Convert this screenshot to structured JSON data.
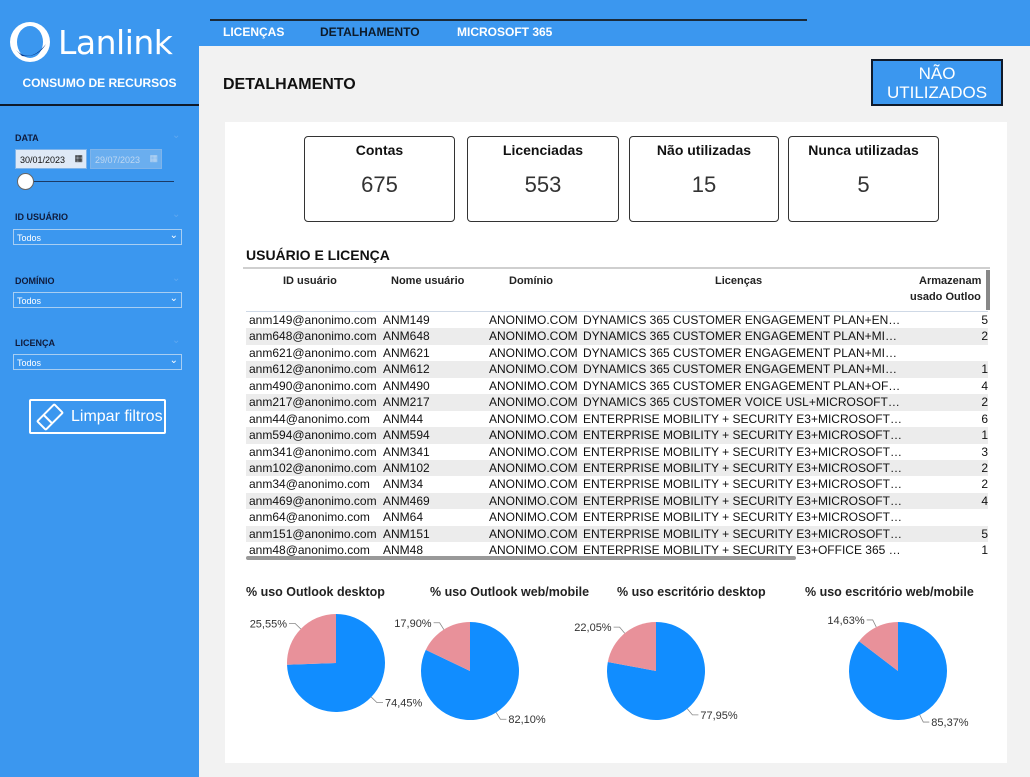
{
  "brand": {
    "name": "Lanlink",
    "subtitle": "CONSUMO DE RECURSOS"
  },
  "colors": {
    "accent": "#3b97ef",
    "pie_main": "#118dff",
    "pie_secondary": "#e8919a"
  },
  "filters": {
    "date": {
      "label": "DATA",
      "start": "30/01/2023",
      "end": "29/07/2023"
    },
    "user_id": {
      "label": "ID USUÁRIO",
      "value": "Todos"
    },
    "domain": {
      "label": "DOMÍNIO",
      "value": "Todos"
    },
    "license": {
      "label": "LICENÇA",
      "value": "Todos"
    },
    "clear_label": "Limpar filtros"
  },
  "tabs": [
    {
      "label": "LICENÇAS",
      "active": false
    },
    {
      "label": "DETALHAMENTO",
      "active": true
    },
    {
      "label": "MICROSOFT 365",
      "active": false
    }
  ],
  "page": {
    "title": "DETALHAMENTO",
    "button": "NÃO UTILIZADOS"
  },
  "kpis": [
    {
      "label": "Contas",
      "value": "675"
    },
    {
      "label": "Licenciadas",
      "value": "553"
    },
    {
      "label": "Não utilizadas",
      "value": "15"
    },
    {
      "label": "Nunca utilizadas",
      "value": "5"
    }
  ],
  "table": {
    "title": "USUÁRIO E LICENÇA",
    "headers": [
      "ID usuário",
      "Nome usuário",
      "Domínio",
      "Licenças",
      "Armazenam",
      "usado Outloo"
    ],
    "rows": [
      [
        "anm149@anonimo.com",
        "ANM149",
        "ANONIMO.COM",
        "DYNAMICS 365 CUSTOMER ENGAGEMENT PLAN+EN…",
        "5"
      ],
      [
        "anm648@anonimo.com",
        "ANM648",
        "ANONIMO.COM",
        "DYNAMICS 365 CUSTOMER ENGAGEMENT PLAN+MI…",
        "2"
      ],
      [
        "anm621@anonimo.com",
        "ANM621",
        "ANONIMO.COM",
        "DYNAMICS 365 CUSTOMER ENGAGEMENT PLAN+MI…",
        ""
      ],
      [
        "anm612@anonimo.com",
        "ANM612",
        "ANONIMO.COM",
        "DYNAMICS 365 CUSTOMER ENGAGEMENT PLAN+MI…",
        "1"
      ],
      [
        "anm490@anonimo.com",
        "ANM490",
        "ANONIMO.COM",
        "DYNAMICS 365 CUSTOMER ENGAGEMENT PLAN+OF…",
        "4"
      ],
      [
        "anm217@anonimo.com",
        "ANM217",
        "ANONIMO.COM",
        "DYNAMICS 365 CUSTOMER VOICE USL+MICROSOFT…",
        "2"
      ],
      [
        "anm44@anonimo.com",
        "ANM44",
        "ANONIMO.COM",
        "ENTERPRISE MOBILITY + SECURITY E3+MICROSOFT…",
        "6"
      ],
      [
        "anm594@anonimo.com",
        "ANM594",
        "ANONIMO.COM",
        "ENTERPRISE MOBILITY + SECURITY E3+MICROSOFT…",
        "1"
      ],
      [
        "anm341@anonimo.com",
        "ANM341",
        "ANONIMO.COM",
        "ENTERPRISE MOBILITY + SECURITY E3+MICROSOFT…",
        "3"
      ],
      [
        "anm102@anonimo.com",
        "ANM102",
        "ANONIMO.COM",
        "ENTERPRISE MOBILITY + SECURITY E3+MICROSOFT…",
        "2"
      ],
      [
        "anm34@anonimo.com",
        "ANM34",
        "ANONIMO.COM",
        "ENTERPRISE MOBILITY + SECURITY E3+MICROSOFT…",
        "2"
      ],
      [
        "anm469@anonimo.com",
        "ANM469",
        "ANONIMO.COM",
        "ENTERPRISE MOBILITY + SECURITY E3+MICROSOFT…",
        "4"
      ],
      [
        "anm64@anonimo.com",
        "ANM64",
        "ANONIMO.COM",
        "ENTERPRISE MOBILITY + SECURITY E3+MICROSOFT…",
        ""
      ],
      [
        "anm151@anonimo.com",
        "ANM151",
        "ANONIMO.COM",
        "ENTERPRISE MOBILITY + SECURITY E3+MICROSOFT…",
        "5"
      ],
      [
        "anm48@anonimo.com",
        "ANM48",
        "ANONIMO.COM",
        "ENTERPRISE MOBILITY + SECURITY E3+OFFICE 365 …",
        "1"
      ]
    ]
  },
  "chart_data": [
    {
      "type": "pie",
      "title": "% uso Outlook desktop",
      "values": [
        74.45,
        25.55
      ],
      "labels": [
        "74,45%",
        "25,55%"
      ]
    },
    {
      "type": "pie",
      "title": "% uso Outlook web/mobile",
      "values": [
        82.1,
        17.9
      ],
      "labels": [
        "82,10%",
        "17,90%"
      ]
    },
    {
      "type": "pie",
      "title": "% uso escritório desktop",
      "values": [
        77.95,
        22.05
      ],
      "labels": [
        "77,95%",
        "22,05%"
      ]
    },
    {
      "type": "pie",
      "title": "% uso escritório web/mobile",
      "values": [
        85.37,
        14.63
      ],
      "labels": [
        "85,37%",
        "14,63%"
      ]
    }
  ]
}
